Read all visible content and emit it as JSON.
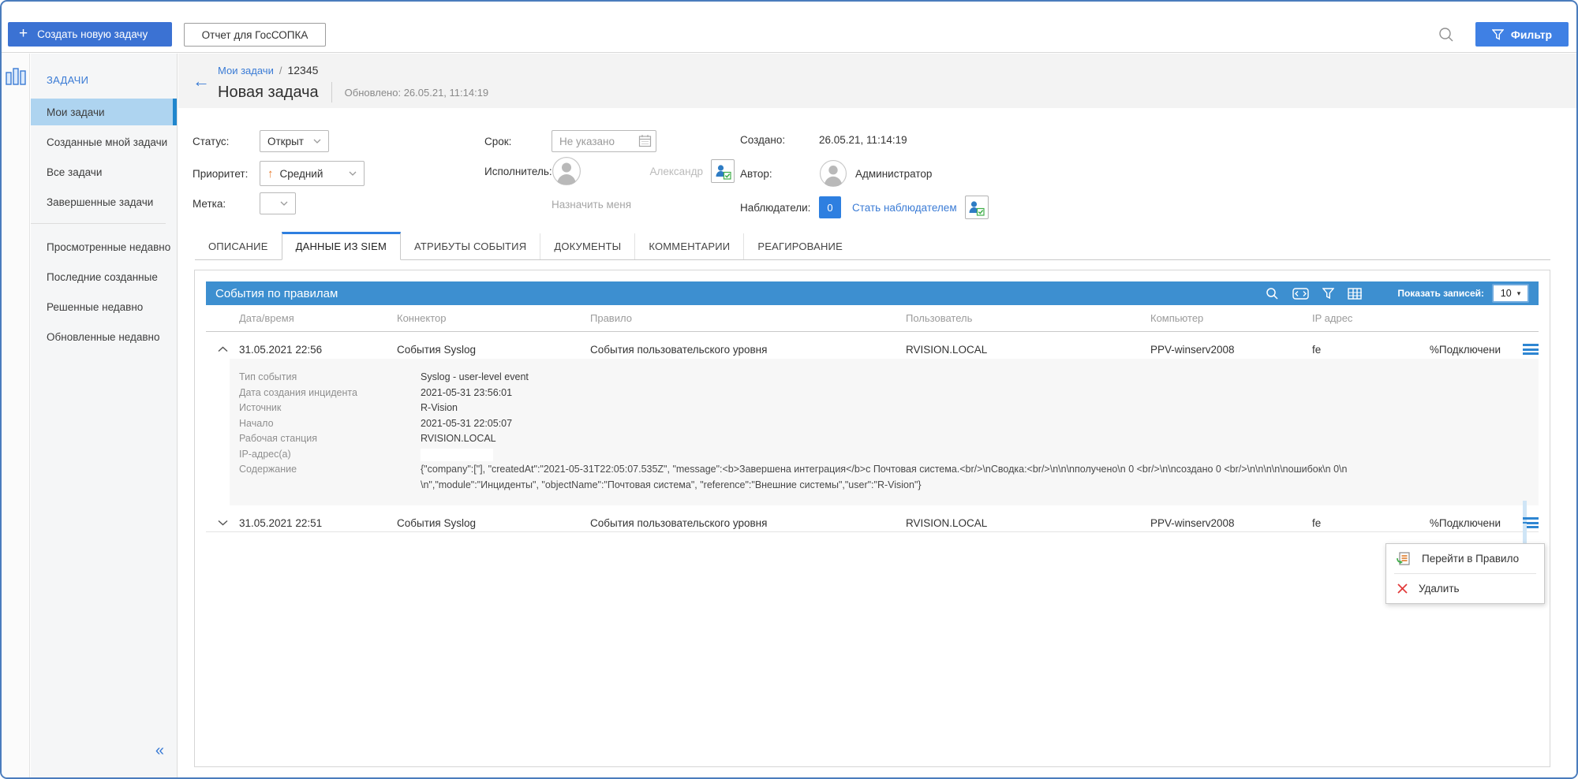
{
  "colors": {
    "primary_blue": "#3b72d3",
    "filter_button_blue": "#3f80e4",
    "link_blue": "#3a7bd5",
    "table_header_bar_blue": "#3d8fd0",
    "sidebar_selected_bg": "#aed4f0",
    "sidebar_selected_bar": "#2086cd",
    "priority_arrow_orange": "#e87b2d",
    "delete_red": "#e23b3b",
    "check_green": "#3fae49",
    "watcher_badge_blue": "#2e7fe0",
    "hamburger_blue": "#2e86d2"
  },
  "icons": {
    "plus": "+",
    "back_arrow": "←",
    "collapse_double_left": "«",
    "priority_up_arrow": "↑",
    "select_caret": "▾"
  },
  "toolbar": {
    "create_task": "Создать новую задачу",
    "gossopka_report": "Отчет для ГосСОПКА",
    "filter": "Фильтр"
  },
  "sidebar": {
    "section": "ЗАДАЧИ",
    "items": [
      {
        "label": "Мои задачи",
        "selected": true
      },
      {
        "label": "Созданные мной задачи",
        "selected": false
      },
      {
        "label": "Все задачи",
        "selected": false
      },
      {
        "label": "Завершенные задачи",
        "selected": false
      },
      {
        "label": "Просмотренные недавно",
        "selected": false
      },
      {
        "label": "Последние созданные",
        "selected": false
      },
      {
        "label": "Решенные недавно",
        "selected": false
      },
      {
        "label": "Обновленные недавно",
        "selected": false
      }
    ]
  },
  "header": {
    "breadcrumb_link": "Мои задачи",
    "breadcrumb_sep": "/",
    "breadcrumb_current": "12345",
    "title": "Новая задача",
    "updated": "Обновлено: 26.05.21, 11:14:19"
  },
  "form": {
    "status_label": "Статус:",
    "status_value": "Открыт",
    "priority_label": "Приоритет:",
    "priority_value": "Средний",
    "tag_label": "Метка:",
    "due_label": "Срок:",
    "due_placeholder": "Не указано",
    "assignee_label": "Исполнитель:",
    "assignee_placeholder": "Александр",
    "assign_me": "Назначить меня",
    "created_label": "Создано:",
    "created_value": "26.05.21, 11:14:19",
    "author_label": "Автор:",
    "author_value": "Администратор",
    "watchers_label": "Наблюдатели:",
    "watchers_count": "0",
    "become_watcher": "Стать наблюдателем"
  },
  "tabs": [
    {
      "label": "ОПИСАНИЕ",
      "active": false
    },
    {
      "label": "ДАННЫЕ ИЗ SIEM",
      "active": true
    },
    {
      "label": "АТРИБУТЫ СОБЫТИЯ",
      "active": false
    },
    {
      "label": "ДОКУМЕНТЫ",
      "active": false
    },
    {
      "label": "КОММЕНТАРИИ",
      "active": false
    },
    {
      "label": "РЕАГИРОВАНИЕ",
      "active": false
    }
  ],
  "events_table": {
    "title": "События по правилам",
    "show_records_label": "Показать записей:",
    "page_size": "10",
    "columns": [
      "Дата/время",
      "Коннектор",
      "Правило",
      "Пользователь",
      "Компьютер",
      "IP адрес"
    ],
    "rows": [
      {
        "datetime": "31.05.2021 22:56",
        "connector": "События Syslog",
        "rule": "События пользовательского уровня",
        "user": "RVISION.LOCAL",
        "computer": "PPV-winserv2008",
        "ip": "fe",
        "extra": "%Подключени",
        "expanded": true
      },
      {
        "datetime": "31.05.2021 22:51",
        "connector": "События Syslog",
        "rule": "События пользовательского уровня",
        "user": "RVISION.LOCAL",
        "computer": "PPV-winserv2008",
        "ip": "fe",
        "extra": "%Подключени",
        "expanded": false
      }
    ],
    "details": [
      {
        "label": "Тип события",
        "value": "Syslog - user-level event"
      },
      {
        "label": "Дата создания инцидента",
        "value": "2021-05-31 23:56:01"
      },
      {
        "label": "Источник",
        "value": "R-Vision"
      },
      {
        "label": "Начало",
        "value": "2021-05-31 22:05:07"
      },
      {
        "label": "Рабочая станция",
        "value": "RVISION.LOCAL"
      },
      {
        "label": "IP-адрес(а)",
        "value": ""
      },
      {
        "label": "Содержание",
        "value": "{\"company\":[\"], \"createdAt\":\"2021-05-31T22:05:07.535Z\", \"message\":<b>Завершена интеграция</b>с Почтовая система.<br/>\\nСводка:<br/>\\n\\n\\nполучено\\n 0 <br/>\\n\\nсоздано 0 <br/>\\n\\n\\n\\n\\nошибок\\n 0\\n\\n\",\"module\":\"Инциденты\", \"objectName\":\"Почтовая система\", \"reference\":\"Внешние системы\",\"user\":\"R-Vision\"}"
      }
    ],
    "context_menu": [
      {
        "label": "Перейти в Правило"
      },
      {
        "label": "Удалить"
      }
    ]
  }
}
